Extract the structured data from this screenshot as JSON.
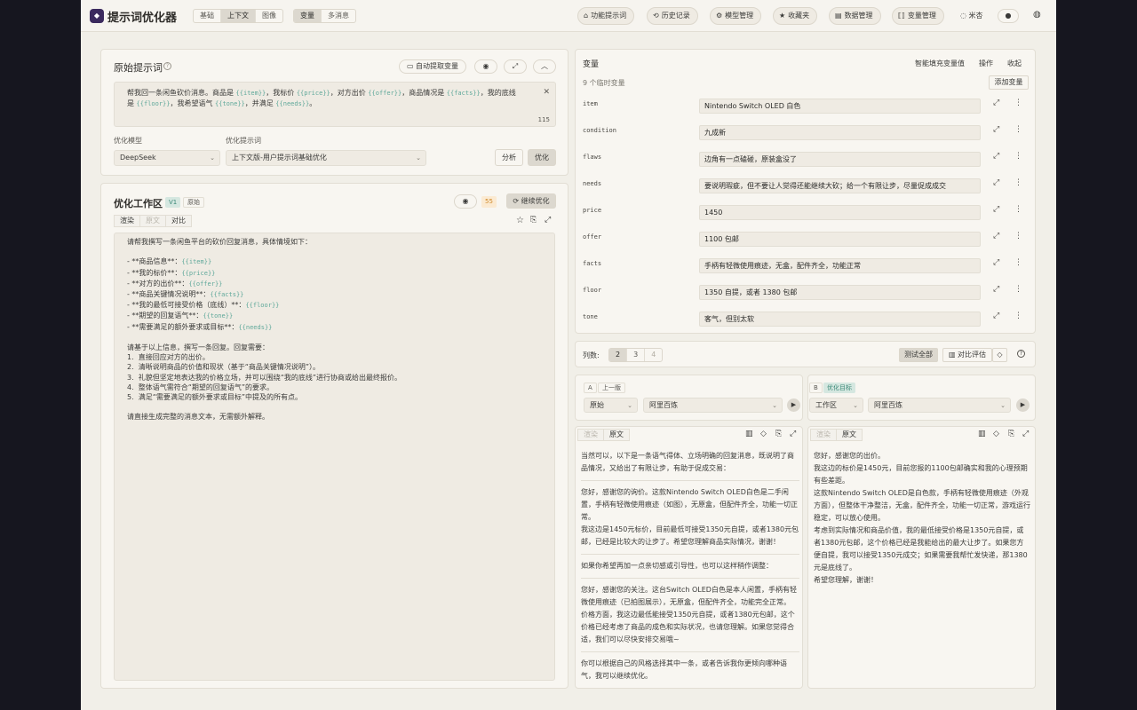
{
  "app": {
    "title": "提示词优化器",
    "logo": "◆"
  },
  "mode_tabs": [
    "基础",
    "上下文",
    "图像"
  ],
  "msg_tabs": [
    "变量",
    "多消息"
  ],
  "nav": [
    {
      "icon": "⌂",
      "label": "功能提示词"
    },
    {
      "icon": "⟲",
      "label": "历史记录"
    },
    {
      "icon": "⚙",
      "label": "模型管理"
    },
    {
      "icon": "★",
      "label": "收藏夹"
    },
    {
      "icon": "▤",
      "label": "数据管理"
    },
    {
      "icon": "⟦⟧",
      "label": "变量管理"
    }
  ],
  "lang": "米杏",
  "original": {
    "title": "原始提示词",
    "help": "?",
    "extract_btn": "自动提取变量",
    "text_parts": [
      {
        "t": "帮我回一条闲鱼砍价消息。商品是 "
      },
      {
        "v": "{{item}}"
      },
      {
        "t": "，我标价 "
      },
      {
        "v": "{{price}}"
      },
      {
        "t": "，对方出价 "
      },
      {
        "v": "{{offer}}"
      },
      {
        "t": "，商品情况是 "
      },
      {
        "v": "{{facts}}"
      },
      {
        "t": "，我的底线是 "
      },
      {
        "v": "{{floor}}"
      },
      {
        "t": "，我希望语气 "
      },
      {
        "v": "{{tone}}"
      },
      {
        "t": "，并满足 "
      },
      {
        "v": "{{needs}}"
      },
      {
        "t": "。"
      }
    ],
    "count": "115",
    "model_label": "优化模型",
    "model_value": "DeepSeek",
    "template_label": "优化提示词",
    "template_value": "上下文版-用户提示词基础优化",
    "analyze_btn": "分析",
    "optimize_btn": "优化"
  },
  "workspace": {
    "title": "优化工作区",
    "version": "V1",
    "orig_tag": "原始",
    "score": "55",
    "continue_btn": "继续优化",
    "tabs": [
      "渲染",
      "原文",
      "对比"
    ],
    "content": [
      {
        "t": "请帮我撰写一条闲鱼平台的砍价回复消息，具体情境如下："
      },
      {
        "t": ""
      },
      {
        "t": "- **商品信息**：",
        "v": "{{item}}"
      },
      {
        "t": "- **我的标价**：",
        "v": "{{price}}"
      },
      {
        "t": "- **对方的出价**：",
        "v": "{{offer}}"
      },
      {
        "t": "- **商品关键情况说明**：",
        "v": "{{facts}}"
      },
      {
        "t": "- **我的最低可接受价格（底线）**：",
        "v": "{{floor}}"
      },
      {
        "t": "- **期望的回复语气**：",
        "v": "{{tone}}"
      },
      {
        "t": "- **需要满足的额外要求或目标**：",
        "v": "{{needs}}"
      },
      {
        "t": ""
      },
      {
        "t": "请基于以上信息，撰写一条回复。回复需要："
      },
      {
        "t": "1.  直接回应对方的出价。"
      },
      {
        "t": "2.  清晰说明商品的价值和现状（基于“商品关键情况说明”）。"
      },
      {
        "t": "3.  礼貌但坚定地表达我的价格立场，并可以围绕“我的底线”进行协商或给出最终报价。"
      },
      {
        "t": "4.  整体语气需符合“期望的回复语气”的要求。"
      },
      {
        "t": "5.  满足“需要满足的额外要求或目标”中提及的所有点。"
      },
      {
        "t": ""
      },
      {
        "t": "请直接生成完整的消息文本，无需额外解释。"
      }
    ]
  },
  "variables": {
    "title": "变量",
    "smart_fill": "智能填充变量值",
    "ops": "操作",
    "collapse": "收起",
    "count_text": "9 个临时变量",
    "add_btn": "添加变量",
    "items": [
      {
        "name": "item",
        "value": "Nintendo Switch OLED 白色"
      },
      {
        "name": "condition",
        "value": "九成新"
      },
      {
        "name": "flaws",
        "value": "边角有一点磕碰，原装盒没了"
      },
      {
        "name": "needs",
        "value": "要说明瑕疵，但不要让人觉得还能继续大砍；给一个有限让步，尽量促成成交"
      },
      {
        "name": "price",
        "value": "1450"
      },
      {
        "name": "offer",
        "value": "1100 包邮"
      },
      {
        "name": "facts",
        "value": "手柄有轻微使用痕迹，无盒，配件齐全，功能正常"
      },
      {
        "name": "floor",
        "value": "1350 自提，或者 1380 包邮"
      },
      {
        "name": "tone",
        "value": "客气，但别太软"
      }
    ]
  },
  "compare_bar": {
    "cols_label": "列数:",
    "cols": [
      "2",
      "3",
      "4"
    ],
    "test_all": "测试全部",
    "compare_eval": "对比评估"
  },
  "col_a": {
    "letter": "A",
    "tag": "上一版",
    "version": "原始",
    "model": "阿里百炼",
    "tabs": [
      "渲染",
      "原文"
    ],
    "paras": [
      "当然可以，以下是一条语气得体、立场明确的回复消息，既说明了商品情况，又给出了有限让步，有助于促成交易：",
      "HR",
      "您好，感谢您的询价。这款Nintendo Switch OLED白色是二手闲置，手柄有轻微使用痕迹（如图），无原盒，但配件齐全，功能一切正常。\n我这边是1450元标价，目前最低可接受1350元自提，或者1380元包邮，已经是比较大的让步了。希望您理解商品实际情况，谢谢！",
      "HR",
      "如果你希望再加一点亲切感或引导性，也可以这样稍作调整：",
      "HR",
      "您好，感谢您的关注。这台Switch OLED白色是本人闲置，手柄有轻微使用痕迹（已拍图展示），无原盒，但配件齐全，功能完全正常。\n价格方面，我这边最低能接受1350元自提，或者1380元包邮，这个价格已经考虑了商品的成色和实际状况，也请您理解。如果您觉得合适，我们可以尽快安排交易哦~",
      "HR",
      "你可以根据自己的风格选择其中一条，或者告诉我你更倾向哪种语气，我可以继续优化。"
    ]
  },
  "col_b": {
    "letter": "B",
    "tag": "优化目标",
    "version": "工作区",
    "model": "阿里百炼",
    "tabs": [
      "渲染",
      "原文"
    ],
    "paras": [
      "您好，感谢您的出价。",
      "我这边的标价是1450元，目前您报的1100包邮确实和我的心理预期有些差距。",
      "这款Nintendo Switch OLED是白色款，手柄有轻微使用痕迹（外观方面），但整体干净整洁，无盒，配件齐全，功能一切正常，游戏运行稳定，可以放心使用。",
      "考虑到实际情况和商品价值，我的最低接受价格是1350元自提，或者1380元包邮，这个价格已经是我能给出的最大让步了。如果您方便自提，我可以接受1350元成交；如果需要我帮忙发快递，那1380元是底线了。",
      "希望您理解，谢谢！"
    ]
  }
}
